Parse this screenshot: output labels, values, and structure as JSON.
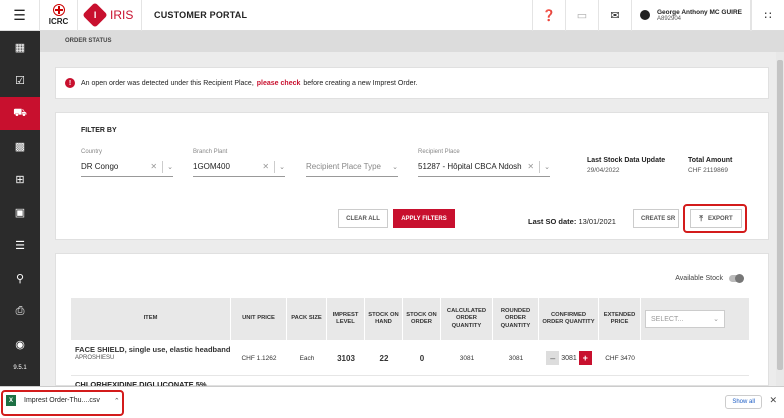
{
  "header": {
    "org_logo_text": "ICRC",
    "app_name": "IRIS",
    "app_badge": "I",
    "portal_title": "CUSTOMER PORTAL",
    "user_name": "George Anthony MC GUIRE",
    "user_id": "A892904"
  },
  "sidebar": {
    "version": "9.5.1"
  },
  "page": {
    "section_title": "ORDER STATUS"
  },
  "alert": {
    "text_before": "An open order was detected under this Recipient Place,",
    "link": "please check",
    "text_after": "before creating a new Imprest Order."
  },
  "filter": {
    "title": "FILTER BY",
    "country": {
      "label": "Country",
      "value": "DR Congo"
    },
    "branch": {
      "label": "Branch Plant",
      "value": "1GOM400"
    },
    "place_type": {
      "placeholder": "Recipient Place Type"
    },
    "recipient": {
      "label": "Recipient Place",
      "value": "51287 - Hôpital CBCA Ndosho"
    },
    "last_stock": {
      "label": "Last Stock Data Update",
      "value": "29/04/2022"
    },
    "total": {
      "label": "Total Amount",
      "value": "CHF 2119869"
    },
    "clear_label": "CLEAR ALL",
    "apply_label": "APPLY FILTERS",
    "last_so_label": "Last SO date:",
    "last_so_value": "13/01/2021",
    "create_label": "CREATE SR",
    "export_label": "EXPORT"
  },
  "table": {
    "available_label": "Available Stock",
    "select_placeholder": "SELECT...",
    "headers": [
      "ITEM",
      "UNIT PRICE",
      "PACK SIZE",
      "IMPREST LEVEL",
      "STOCK ON HAND",
      "STOCK ON ORDER",
      "CALCULATED ORDER QUANTITY",
      "ROUNDED ORDER QUANTITY",
      "CONFIRMED ORDER QUANTITY",
      "EXTENDED PRICE"
    ],
    "rows": [
      {
        "item": "FACE SHIELD, single use, elastic headband",
        "code": "APROSHIESU",
        "unit_price": "CHF 1.1262",
        "pack_size": "Each",
        "imprest": "3103",
        "on_hand": "22",
        "on_order": "0",
        "calculated": "3081",
        "rounded": "3081",
        "confirmed": "3081",
        "extended": "CHF 3470"
      }
    ],
    "next_row_partial": "CHLORHEXIDINE DIGLUCONATE 5%"
  },
  "downloads": {
    "file": "Imprest Order-Thu....csv",
    "show_all": "Show all"
  }
}
